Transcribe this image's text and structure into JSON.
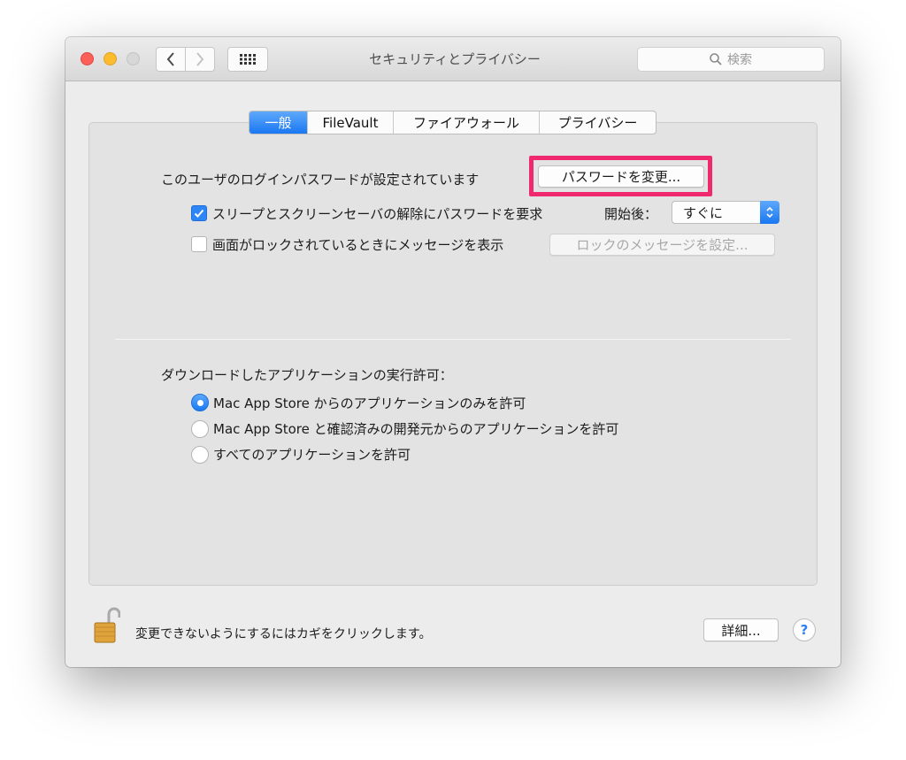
{
  "window": {
    "title": "セキュリティとプライバシー",
    "search_placeholder": "検索"
  },
  "tabs": [
    {
      "label": "一般",
      "active": true
    },
    {
      "label": "FileVault",
      "active": false
    },
    {
      "label": "ファイアウォール",
      "active": false
    },
    {
      "label": "プライバシー",
      "active": false
    }
  ],
  "general": {
    "password_text": "このユーザのログインパスワードが設定されています",
    "change_password_label": "パスワードを変更...",
    "require_password": {
      "checked": true,
      "label": "スリープとスクリーンセーバの解除にパスワードを要求",
      "after_label": "開始後：",
      "selected_option": "すぐに"
    },
    "lock_message": {
      "checked": false,
      "label": "画面がロックされているときにメッセージを表示",
      "button_label": "ロックのメッセージを設定..."
    }
  },
  "downloads": {
    "heading": "ダウンロードしたアプリケーションの実行許可：",
    "options": [
      {
        "label": "Mac App Store からのアプリケーションのみを許可",
        "selected": true
      },
      {
        "label": "Mac App Store と確認済みの開発元からのアプリケーションを許可",
        "selected": false
      },
      {
        "label": "すべてのアプリケーションを許可",
        "selected": false
      }
    ]
  },
  "footer": {
    "lock_text": "変更できないようにするにはカギをクリックします。",
    "details_label": "詳細...",
    "help_label": "?"
  },
  "colors": {
    "accent": "#1a78f2",
    "highlight": "#f0296f"
  }
}
